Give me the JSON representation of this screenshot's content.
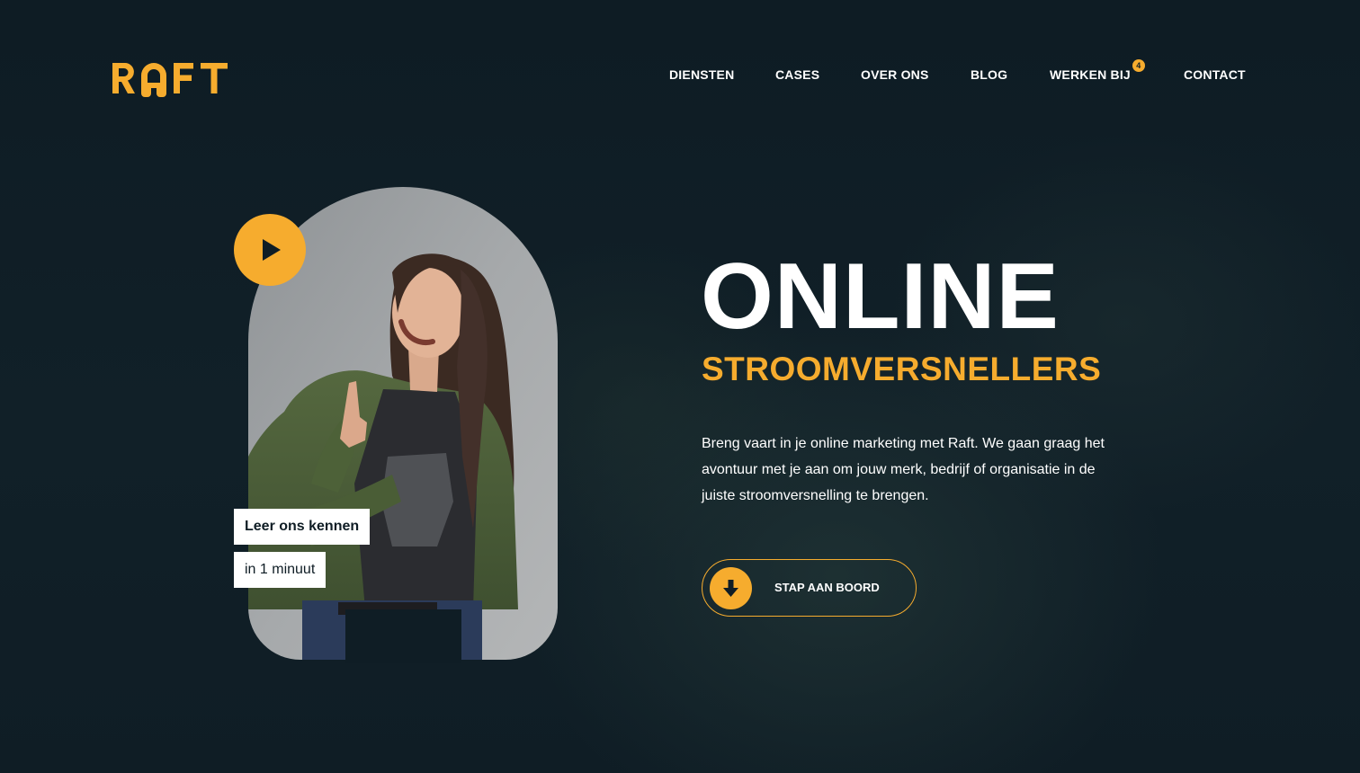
{
  "brand": {
    "logo_text": "RAFT",
    "accent_color": "#f6ac2e",
    "background_color": "#0f1d25",
    "text_color": "#ffffff"
  },
  "nav": {
    "items": [
      {
        "label": "DIENSTEN"
      },
      {
        "label": "CASES"
      },
      {
        "label": "OVER ONS"
      },
      {
        "label": "BLOG"
      },
      {
        "label": "WERKEN BIJ",
        "badge": "4"
      },
      {
        "label": "CONTACT"
      }
    ]
  },
  "hero": {
    "title": "ONLINE",
    "subtitle": "STROOMVERSNELLERS",
    "intro": "Breng vaart in je online marketing met Raft. We gaan graag het avontuur met je aan om jouw merk, bedrijf of organisatie in de juiste stroomversnelling te brengen.",
    "cta_label": "STAP AAN BOORD",
    "cta_icon": "arrow-down-icon"
  },
  "video": {
    "play_icon": "play-icon",
    "tag_primary": "Leer ons kennen",
    "tag_secondary": "in 1 minuut"
  }
}
